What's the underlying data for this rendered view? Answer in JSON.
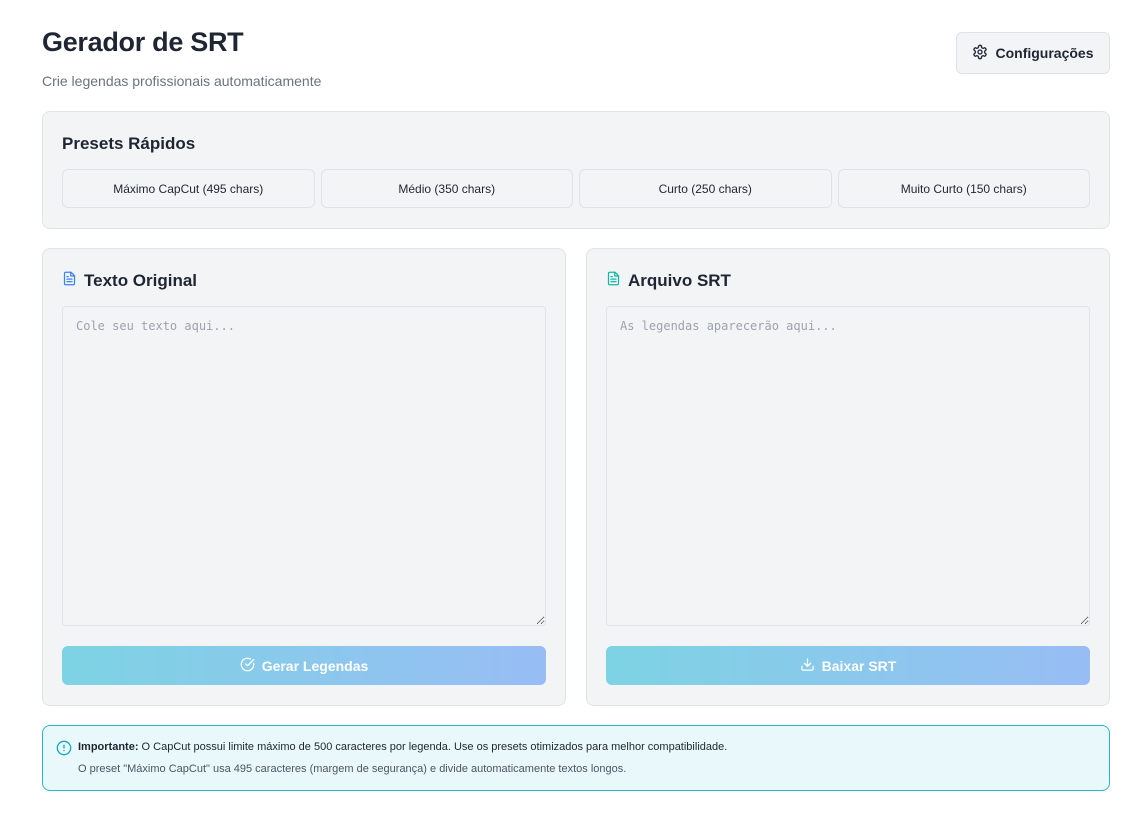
{
  "header": {
    "title": "Gerador de SRT",
    "subtitle": "Crie legendas profissionais automaticamente",
    "config_label": "Configurações"
  },
  "presets": {
    "title": "Presets Rápidos",
    "items": [
      {
        "label": "Máximo CapCut (495 chars)"
      },
      {
        "label": "Médio (350 chars)"
      },
      {
        "label": "Curto (250 chars)"
      },
      {
        "label": "Muito Curto (150 chars)"
      }
    ]
  },
  "input_panel": {
    "title": "Texto Original",
    "placeholder": "Cole seu texto aqui...",
    "value": "",
    "button_label": "Gerar Legendas",
    "icon": "file-text-icon"
  },
  "output_panel": {
    "title": "Arquivo SRT",
    "placeholder": "As legendas aparecerão aqui...",
    "value": "",
    "button_label": "Baixar SRT",
    "icon": "file-text-icon"
  },
  "notice": {
    "strong": "Importante:",
    "text": " O CapCut possui limite máximo de 500 caracteres por legenda. Use os presets otimizados para melhor compatibilidade.",
    "detail": "O preset \"Máximo CapCut\" usa 495 caracteres (margem de segurança) e divide automaticamente textos longos."
  },
  "colors": {
    "accent_blue": "#3b82f6",
    "accent_teal": "#14b8a6",
    "button_gradient_start": "#7dd3e3",
    "button_gradient_end": "#98bdf5",
    "notice_border": "#27b6c4",
    "notice_bg": "#e8f8fb"
  }
}
